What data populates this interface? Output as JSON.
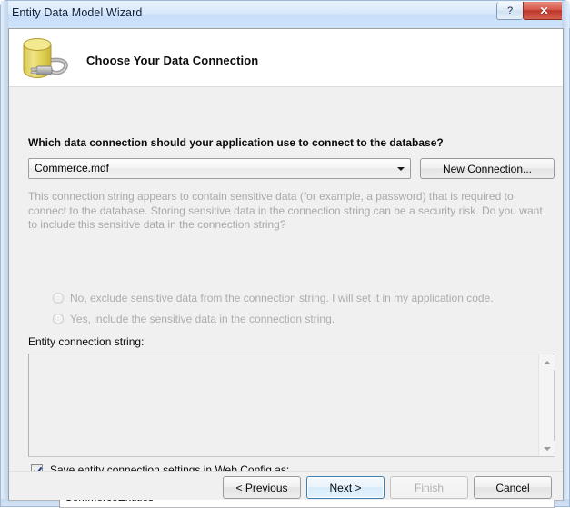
{
  "window": {
    "title": "Entity Data Model Wizard",
    "help_button_label": "?",
    "close_button_label": "✕"
  },
  "header": {
    "icon_name": "database-connection-icon",
    "title": "Choose Your Data Connection"
  },
  "main": {
    "prompt": "Which data connection should your application use to connect to the database?",
    "connection_combo": {
      "value": "Commerce.mdf",
      "arrow_icon": "chevron-down-icon"
    },
    "new_connection_button": "New Connection...",
    "sensitive_info": "This connection string appears to contain sensitive data (for example, a password) that is required to connect to the database. Storing sensitive data in the connection string can be a security risk. Do you want to include this sensitive data in the connection string?",
    "radios": [
      {
        "label": "No, exclude sensitive data from the connection string. I will set it in my application code.",
        "selected": false,
        "enabled": false
      },
      {
        "label": "Yes, include the sensitive data in the connection string.",
        "selected": false,
        "enabled": false
      }
    ],
    "entity_connection_string_label": "Entity connection string:",
    "entity_connection_string_value": "",
    "save_checkbox": {
      "label": "Save entity connection settings in Web.Config as:",
      "checked": true
    },
    "settings_name_value": "CommerceEntities"
  },
  "footer": {
    "buttons": [
      {
        "label": "< Previous",
        "state": "enabled"
      },
      {
        "label": "Next >",
        "state": "default-focused"
      },
      {
        "label": "Finish",
        "state": "disabled"
      },
      {
        "label": "Cancel",
        "state": "enabled"
      }
    ]
  },
  "colors": {
    "window_frame": "#c3d8f0",
    "client_background": "#f0f0f0",
    "header_background": "#ffffff",
    "close_button": "#bb3529",
    "focus_border": "#3c7fb1",
    "disabled_text": "#adadad",
    "database_icon": "#e2d25e"
  }
}
